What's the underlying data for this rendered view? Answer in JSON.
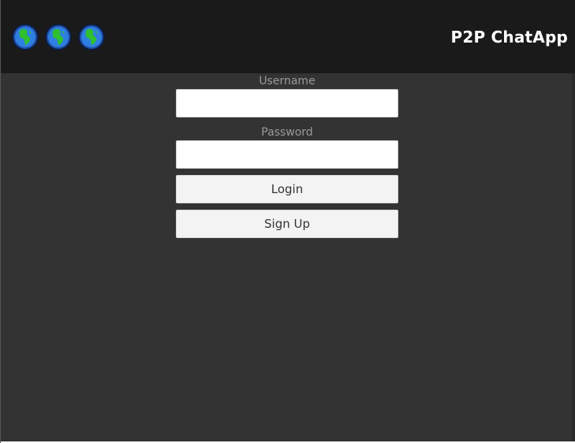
{
  "header": {
    "title": "P2P ChatApp",
    "icons": [
      "globe-africa-icon",
      "globe-africa-icon",
      "globe-africa-icon"
    ]
  },
  "form": {
    "username_label": "Username",
    "username_value": "",
    "password_label": "Password",
    "password_value": "",
    "login_label": "Login",
    "signup_label": "Sign Up"
  },
  "colors": {
    "header_bg": "#1a1a1a",
    "body_bg": "#333333",
    "label_text": "#9a9a9a",
    "button_bg": "#f3f3f3"
  }
}
